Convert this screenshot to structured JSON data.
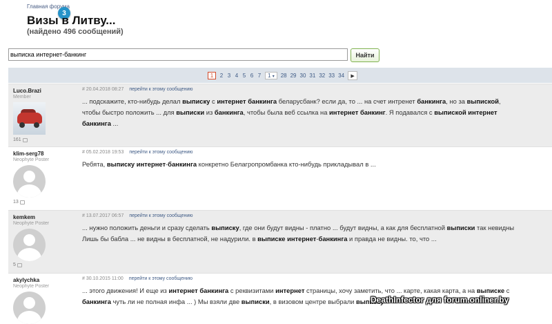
{
  "breadcrumb": "Главная форума",
  "badge": "3",
  "page_title": "Визы в Литву...",
  "found": "(найдено 496 сообщений)",
  "search": {
    "value": "выписка интернет-банкинг",
    "button": "Найти"
  },
  "pagination": {
    "current": "1",
    "pages_a": [
      "2",
      "3",
      "4",
      "5",
      "6",
      "7"
    ],
    "dropdown": "1",
    "dropdown_icon": "chevron-down-icon",
    "pages_b": [
      "28",
      "29",
      "30",
      "31",
      "32",
      "33",
      "34"
    ],
    "next_icon": "arrow-right-icon"
  },
  "posts": [
    {
      "author": "Luco.Brazi",
      "role": "Member",
      "count": "161",
      "date": "# 20.04.2018 08:27",
      "link": "перейти к этому сообщению",
      "segments": [
        {
          "t": "... подскажите, кто-нибудь делал "
        },
        {
          "t": "выписку",
          "b": true
        },
        {
          "t": " с "
        },
        {
          "t": "интернет банкинга",
          "b": true
        },
        {
          "t": " беларусбанк? если да, то ... на счет интренет "
        },
        {
          "t": "банкинга",
          "b": true
        },
        {
          "t": ", но за "
        },
        {
          "t": "выпиской",
          "b": true
        },
        {
          "t": ", чтобы быстро положить ... для "
        },
        {
          "t": "выписки",
          "b": true
        },
        {
          "t": " из "
        },
        {
          "t": "банкинга",
          "b": true
        },
        {
          "t": ", чтобы была веб ссылка на "
        },
        {
          "t": "интернет банкинг",
          "b": true
        },
        {
          "t": ". Я подавался с "
        },
        {
          "t": "выпиской интернет банкинга",
          "b": true
        },
        {
          "t": " ..."
        }
      ]
    },
    {
      "author": "klim-serg78",
      "role": "Neophyte Poster",
      "count": "13",
      "date": "# 05.02.2018 19:53",
      "link": "перейти к этому сообщению",
      "segments": [
        {
          "t": "Ребята, "
        },
        {
          "t": "выписку интернет",
          "b": true
        },
        {
          "t": "-"
        },
        {
          "t": "банкинга",
          "b": true
        },
        {
          "t": " конкретно Белагропромбанка кто-нибудь прикладывал в ..."
        }
      ]
    },
    {
      "author": "kemkem",
      "role": "Neophyte Poster",
      "count": "5",
      "date": "# 13.07.2017 06:57",
      "link": "перейти к этому сообщению",
      "segments": [
        {
          "t": "... нужно положить деньги и сразу сделать "
        },
        {
          "t": "выписку",
          "b": true
        },
        {
          "t": ", где они будут видны - платно ... будут видны, а как для бесплатной "
        },
        {
          "t": "выписки",
          "b": true
        },
        {
          "t": " так невидны Лишь бы бабла ... не видны в бесплатной, не надурили. в "
        },
        {
          "t": "выписке интернет",
          "b": true
        },
        {
          "t": "-"
        },
        {
          "t": "банкинга",
          "b": true
        },
        {
          "t": " и правда не видны. то, что ..."
        }
      ]
    },
    {
      "author": "akylychka",
      "role": "Neophyte Poster",
      "count": "",
      "date": "# 30.10.2015 11:00",
      "link": "перейти к этому сообщению",
      "segments": [
        {
          "t": "... этого движения! И еще из "
        },
        {
          "t": "интернет банкинга",
          "b": true
        },
        {
          "t": " с реквизитами "
        },
        {
          "t": "интернет",
          "b": true
        },
        {
          "t": " страницы, хочу заметить, что ... карте, какая карта, а на "
        },
        {
          "t": "выписке",
          "b": true
        },
        {
          "t": " с "
        },
        {
          "t": "банкинга",
          "b": true
        },
        {
          "t": " чуть ли не полная инфа ... ) Мы взяли две "
        },
        {
          "t": "выписки",
          "b": true
        },
        {
          "t": ", в визовом центре выбрали "
        },
        {
          "t": "выписку",
          "b": true
        }
      ]
    }
  ],
  "watermark": "DeathInfector для forum.onliner.by"
}
